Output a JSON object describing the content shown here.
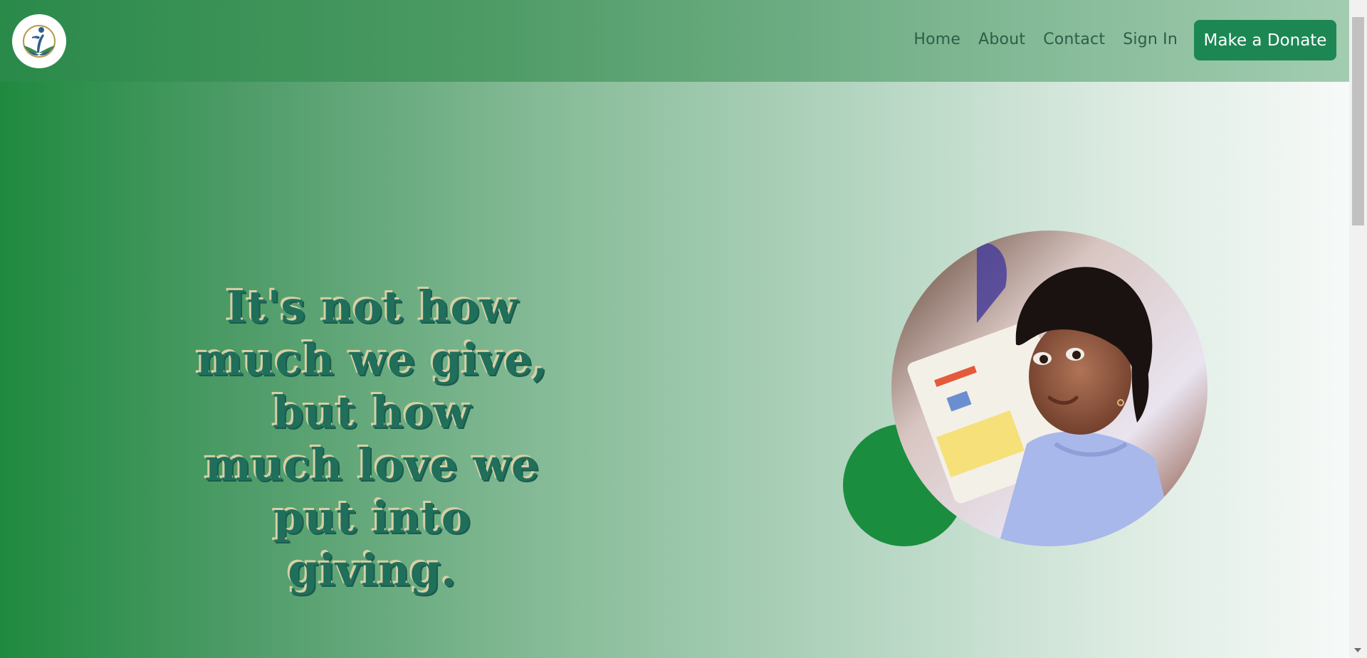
{
  "brand": {
    "logo_icon": "charity-person-leaves-icon",
    "colors": {
      "primary": "#1c8753",
      "accent": "#1b8d3f",
      "quote_text": "#1f6f5b",
      "quote_highlight": "#d8cfa4"
    }
  },
  "nav": {
    "items": [
      {
        "label": "Home"
      },
      {
        "label": "About"
      },
      {
        "label": "Contact"
      },
      {
        "label": "Sign In"
      }
    ],
    "donate_label": "Make a Donate"
  },
  "hero": {
    "quote_lines": [
      "It's not how",
      "much we give,",
      "but how",
      "much love we",
      "put into",
      "giving."
    ],
    "image_icon": "child-portrait-photo"
  }
}
